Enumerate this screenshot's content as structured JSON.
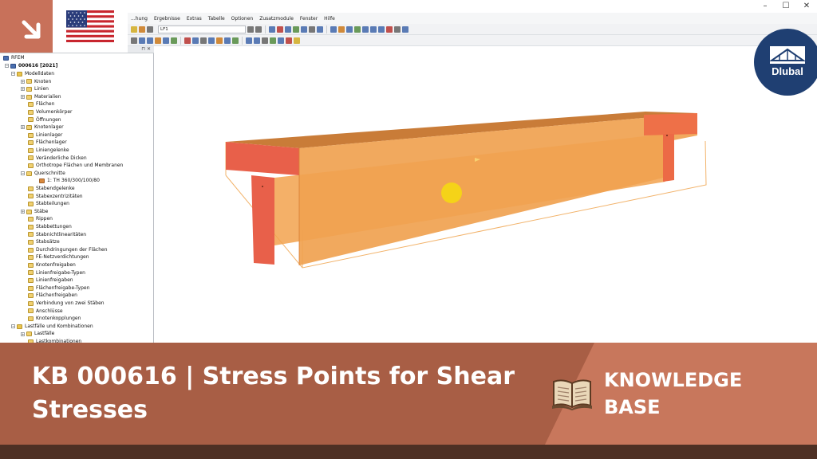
{
  "window": {
    "minimize_glyph": "–",
    "maximize_glyph": "☐",
    "close_glyph": "✕"
  },
  "menu": {
    "items": [
      "...hung",
      "Ergebnisse",
      "Extras",
      "Tabelle",
      "Optionen",
      "Zusatzmodule",
      "Fenster",
      "Hilfe"
    ]
  },
  "toolbar": {
    "loadcase_combo": "LF1"
  },
  "navigator": {
    "root": "RFEM",
    "project": "000616 [2021]",
    "items": [
      {
        "label": "Modelldaten",
        "level": 1,
        "expander": "−",
        "icon": "folder"
      },
      {
        "label": "Knoten",
        "level": 2,
        "expander": "+",
        "icon": "item"
      },
      {
        "label": "Linien",
        "level": 2,
        "expander": "+",
        "icon": "item"
      },
      {
        "label": "Materialien",
        "level": 2,
        "expander": "+",
        "icon": "item"
      },
      {
        "label": "Flächen",
        "level": 2,
        "expander": "",
        "icon": "item"
      },
      {
        "label": "Volumenkörper",
        "level": 2,
        "expander": "",
        "icon": "item"
      },
      {
        "label": "Öffnungen",
        "level": 2,
        "expander": "",
        "icon": "item"
      },
      {
        "label": "Knotenlager",
        "level": 2,
        "expander": "+",
        "icon": "item"
      },
      {
        "label": "Linienlager",
        "level": 2,
        "expander": "",
        "icon": "item"
      },
      {
        "label": "Flächenlager",
        "level": 2,
        "expander": "",
        "icon": "item"
      },
      {
        "label": "Liniengelenke",
        "level": 2,
        "expander": "",
        "icon": "item"
      },
      {
        "label": "Veränderliche Dicken",
        "level": 2,
        "expander": "",
        "icon": "item"
      },
      {
        "label": "Orthotrope Flächen und Membranen",
        "level": 2,
        "expander": "",
        "icon": "item"
      },
      {
        "label": "Querschnitte",
        "level": 2,
        "expander": "−",
        "icon": "item"
      },
      {
        "label": "1: TH 360/300/100/80",
        "level": 3,
        "expander": "",
        "icon": "cs"
      },
      {
        "label": "Stabendgelenke",
        "level": 2,
        "expander": "",
        "icon": "item"
      },
      {
        "label": "Stabexzentrizitäten",
        "level": 2,
        "expander": "",
        "icon": "item"
      },
      {
        "label": "Stabteilungen",
        "level": 2,
        "expander": "",
        "icon": "item"
      },
      {
        "label": "Stäbe",
        "level": 2,
        "expander": "+",
        "icon": "item"
      },
      {
        "label": "Rippen",
        "level": 2,
        "expander": "",
        "icon": "item"
      },
      {
        "label": "Stabbettungen",
        "level": 2,
        "expander": "",
        "icon": "item"
      },
      {
        "label": "Stabnichtlinearitäten",
        "level": 2,
        "expander": "",
        "icon": "item"
      },
      {
        "label": "Stabsätze",
        "level": 2,
        "expander": "",
        "icon": "item"
      },
      {
        "label": "Durchdringungen der Flächen",
        "level": 2,
        "expander": "",
        "icon": "item"
      },
      {
        "label": "FE-Netzverdichtungen",
        "level": 2,
        "expander": "",
        "icon": "item"
      },
      {
        "label": "Knotenfreigaben",
        "level": 2,
        "expander": "",
        "icon": "item"
      },
      {
        "label": "Linienfreigabe-Typen",
        "level": 2,
        "expander": "",
        "icon": "item"
      },
      {
        "label": "Linienfreigaben",
        "level": 2,
        "expander": "",
        "icon": "item"
      },
      {
        "label": "Flächenfreigabe-Typen",
        "level": 2,
        "expander": "",
        "icon": "item"
      },
      {
        "label": "Flächenfreigaben",
        "level": 2,
        "expander": "",
        "icon": "item"
      },
      {
        "label": "Verbindung von zwei Stäben",
        "level": 2,
        "expander": "",
        "icon": "item"
      },
      {
        "label": "Anschlüsse",
        "level": 2,
        "expander": "",
        "icon": "item"
      },
      {
        "label": "Knotenkopplungen",
        "level": 2,
        "expander": "",
        "icon": "item"
      },
      {
        "label": "Lastfälle und Kombinationen",
        "level": 1,
        "expander": "−",
        "icon": "folder"
      },
      {
        "label": "Lastfälle",
        "level": 2,
        "expander": "+",
        "icon": "item"
      },
      {
        "label": "Lastkombinationen",
        "level": 2,
        "expander": "",
        "icon": "item"
      }
    ]
  },
  "logo": {
    "brand": "Dlubal"
  },
  "banner": {
    "title": "KB 000616 | Stress Points for Shear Stresses",
    "label": "KNOWLEDGE BASE"
  },
  "colors": {
    "banner_left": "#a85e45",
    "banner_right": "#c8775c",
    "footer": "#4e3024",
    "beam_orange": "#f0a250",
    "beam_red": "#e8604a",
    "stress_point": "#f5d318",
    "logo_blue": "#1f3f72"
  }
}
